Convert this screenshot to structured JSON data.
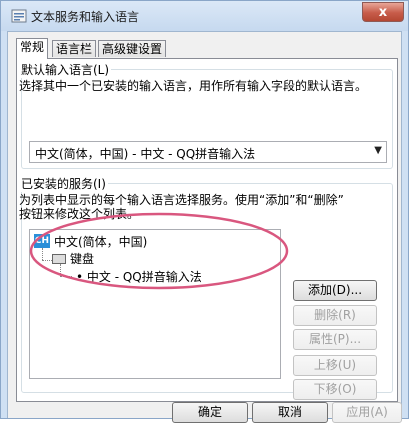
{
  "window": {
    "title": "文本服务和输入语言",
    "close_symbol": "x"
  },
  "tabs": [
    {
      "label": "常规",
      "active": true
    },
    {
      "label": "语言栏",
      "active": false
    },
    {
      "label": "高级键设置",
      "active": false
    }
  ],
  "default_language": {
    "legend": "默认输入语言(L)",
    "description": "选择其中一个已安装的输入语言，用作所有输入字段的默认语言。",
    "selected": "中文(简体，中国) - 中文 - QQ拼音输入法"
  },
  "installed_services": {
    "legend": "已安装的服务(I)",
    "description_line1": "为列表中显示的每个输入语言选择服务。使用“添加”和“删除”",
    "description_line2": "按钮来修改这个列表。",
    "tree": {
      "language": "中文(简体，中国)",
      "language_badge": "CH",
      "category": "键盘",
      "service": "• 中文 - QQ拼音输入法"
    },
    "buttons": {
      "add": "添加(D)...",
      "remove": "删除(R)",
      "properties": "属性(P)...",
      "move_up": "上移(U)",
      "move_down": "下移(O)"
    }
  },
  "footer": {
    "ok": "确定",
    "cancel": "取消",
    "apply": "应用(A)"
  },
  "colors": {
    "annotation": "#d9577f",
    "title_bg": "#cfe0f3"
  }
}
